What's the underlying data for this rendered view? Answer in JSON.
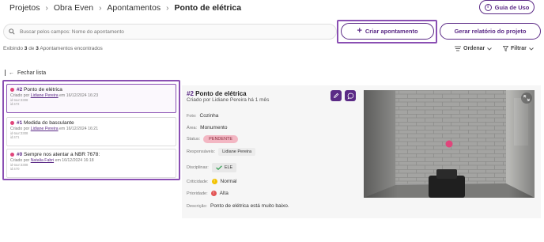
{
  "breadcrumb": {
    "items": [
      "Projetos",
      "Obra Even",
      "Apontamentos"
    ],
    "current": "Ponto de elétrica",
    "separator": "›"
  },
  "guide_button": {
    "label": "Guia de Uso",
    "icon": "info-icon"
  },
  "search": {
    "placeholder": "Buscar pelos campos: Nome do apontamento",
    "icon": "search-icon"
  },
  "actions": {
    "create_label": "Criar apontamento",
    "create_icon": "plus-icon",
    "report_label": "Gerar relatório do projeto"
  },
  "counter": {
    "prefix": "Exibindo",
    "shown": "3",
    "of": "de",
    "total": "3",
    "suffix": "Apontamentos encontrados"
  },
  "toolbar": {
    "sort_label": "Ordenar",
    "filter_label": "Filtrar"
  },
  "list": {
    "close_label": "Fechar lista",
    "items": [
      {
        "dot_color": "#e0457b",
        "number": "#2",
        "title": "Ponto de elétrica",
        "created_prefix": "Criado por",
        "author": "Lidiane Pereira",
        "created_suffix": "em 16/12/2024 16:23",
        "meta1": "id-tour:3308",
        "meta2": "id:472"
      },
      {
        "dot_color": "#e0457b",
        "number": "#1",
        "title": "Medida do basculante",
        "created_prefix": "Criado por",
        "author": "Lidiane Pereira",
        "created_suffix": "em 16/12/2024 16:21",
        "meta1": "id-tour:3308",
        "meta2": "id:471"
      },
      {
        "dot_color": "#e0457b",
        "number": "#0",
        "title": "Sempre nos atentar a NBR 7678:",
        "created_prefix": "Criado por",
        "author": "Natalia Fabri",
        "created_suffix": "em 16/12/2024 16:18",
        "meta1": "id-tour:3308",
        "meta2": "id:470"
      }
    ]
  },
  "detail": {
    "number": "#2",
    "title": "Ponto de elétrica",
    "subtitle": "Criado por Lidiane Pereira há 1 mês",
    "edit_icon": "pencil-icon",
    "comment_icon": "chat-icon",
    "fields": {
      "foto_label": "Foto:",
      "foto_value": "Cozinha",
      "area_label": "Área:",
      "area_value": "Monumento",
      "status_label": "Status:",
      "status_value": "PENDENTE",
      "resp_label": "Responsáveis:",
      "resp_value": "Lidiane Pereira",
      "disc_label": "Disciplinas:",
      "disc_value": "ELE",
      "crit_label": "Criticidade:",
      "crit_value": "Normal",
      "prio_label": "Prioridade:",
      "prio_value": "Alta",
      "desc_label": "Descrição:",
      "desc_value": "Ponto de elétrica está muito baixo."
    },
    "colors": {
      "accent": "#5b2a86",
      "status_bg": "#f3b7c3",
      "marker": "#e0457b"
    }
  }
}
